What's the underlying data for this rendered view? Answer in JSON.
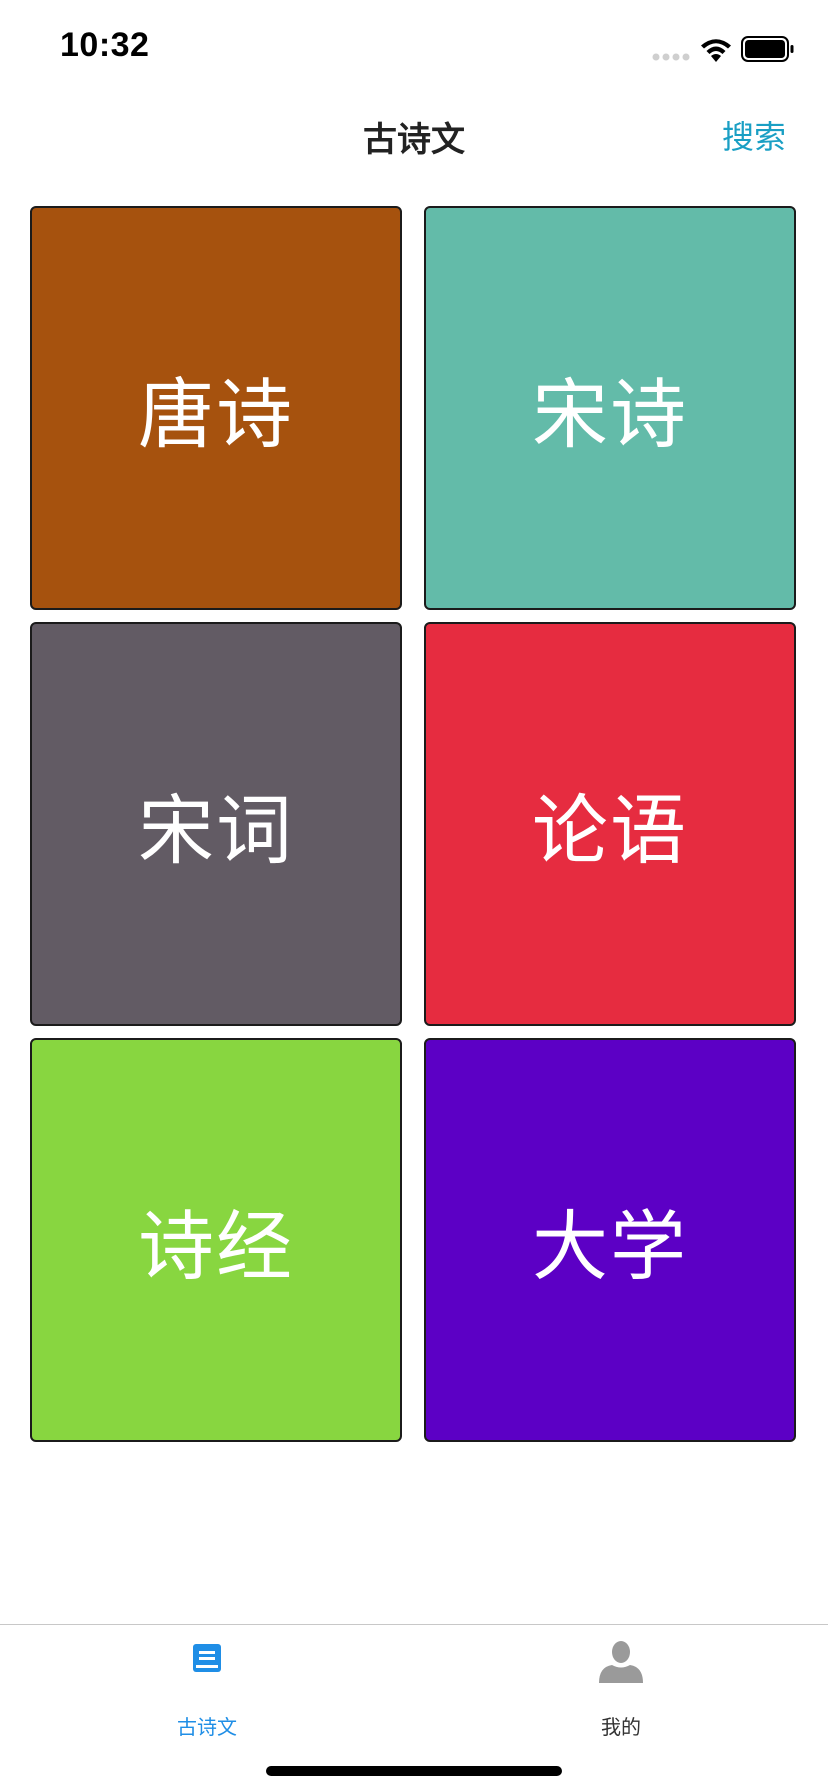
{
  "status_bar": {
    "time": "10:32",
    "icons": [
      "signal-icon",
      "wifi-icon",
      "battery-icon"
    ]
  },
  "nav": {
    "title": "古诗文",
    "search_label": "搜索",
    "search_color": "#1a9fc4"
  },
  "tiles": [
    {
      "label": "唐诗",
      "color": "#a6520e"
    },
    {
      "label": "宋诗",
      "color": "#63bba9"
    },
    {
      "label": "宋词",
      "color": "#625b64"
    },
    {
      "label": "论语",
      "color": "#e62c40"
    },
    {
      "label": "诗经",
      "color": "#88d640"
    },
    {
      "label": "大学",
      "color": "#5c00c5"
    }
  ],
  "tab_bar": {
    "tabs": [
      {
        "label": "古诗文",
        "icon": "document-icon",
        "selected": true,
        "color": "#1f8ee6"
      },
      {
        "label": "我的",
        "icon": "user-icon",
        "selected": false,
        "color": "#333333"
      }
    ]
  }
}
